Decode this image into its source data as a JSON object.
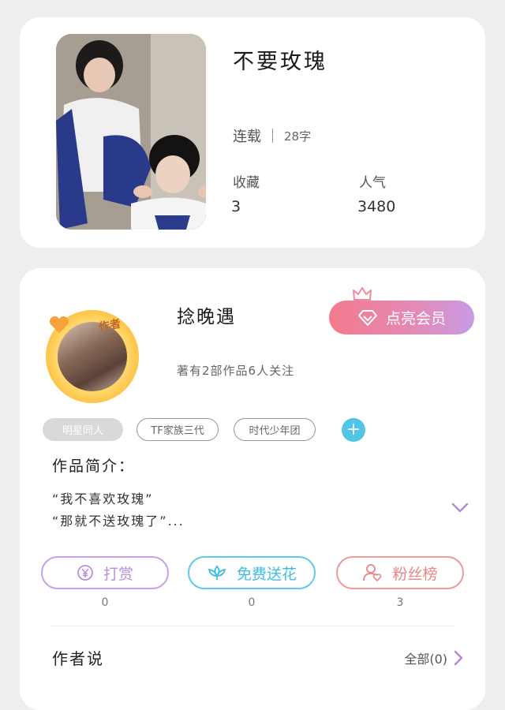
{
  "book": {
    "title": "不要玫瑰",
    "status": "连载",
    "word_count": "28字",
    "favorites_label": "收藏",
    "favorites_value": "3",
    "popularity_label": "人气",
    "popularity_value": "3480"
  },
  "author": {
    "badge": "作者",
    "name": "捻晚遇",
    "meta": "著有2部作品6人关注",
    "vip_label": "点亮会员",
    "tags": [
      "明星同人",
      "TF家族三代",
      "时代少年团"
    ],
    "add_tag_symbol": "+",
    "intro_title": "作品简介：",
    "intro_lines": [
      "“我不喜欢玫瑰”",
      "“那就不送玫瑰了”..."
    ]
  },
  "actions": {
    "reward_label": "打赏",
    "reward_count": "0",
    "flower_label": "免费送花",
    "flower_count": "0",
    "fans_label": "粉丝榜",
    "fans_count": "3"
  },
  "author_say": {
    "title": "作者说",
    "all_label": "全部(0)"
  },
  "colors": {
    "vip_gradient_start": "#f47a8c",
    "vip_gradient_end": "#c79be4",
    "add_tag": "#4fc6e8",
    "reward": "#b98fdc",
    "flower": "#3fbde0",
    "fans": "#e88585",
    "expand_chevron": "#b48ad6"
  },
  "icons": {
    "reward": "yen-coin-icon",
    "flower": "lotus-flower-icon",
    "fans": "user-heart-icon",
    "vip": "diamond-icon",
    "crown": "crown-icon",
    "expand": "chevron-down-icon",
    "all": "chevron-right-icon"
  }
}
